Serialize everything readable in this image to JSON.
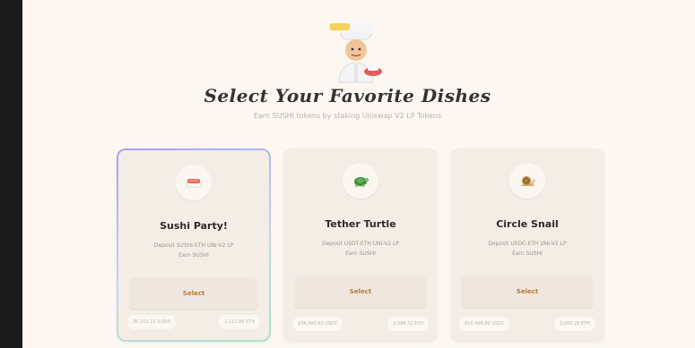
{
  "header": {
    "title": "Select Your Favorite Dishes",
    "subtitle": "Earn SUSHI tokens by staking Uniswap V2 LP Tokens",
    "mascot_icon": "chef-icon"
  },
  "cards": [
    {
      "name": "Sushi Party!",
      "icon": "sushi-icon",
      "desc_line1": "Deposit SUSHI-ETH UNI-V2 LP",
      "desc_line2": "Earn SUSHI",
      "button_label": "Select",
      "stat_left": "20,101.22 SUSHI",
      "stat_right": "1,111.86 ETH",
      "selected": true
    },
    {
      "name": "Tether Turtle",
      "icon": "turtle-icon",
      "desc_line1": "Deposit USDT-ETH UNI-V2 LP",
      "desc_line2": "Earn SUSHI",
      "button_label": "Select",
      "stat_left": "836,489.83 USDT",
      "stat_right": "3,098.52 ETH",
      "selected": false
    },
    {
      "name": "Circle Snail",
      "icon": "snail-icon",
      "desc_line1": "Deposit USDC-ETH UNI-V2 LP",
      "desc_line2": "Earn SUSHI",
      "button_label": "Select",
      "stat_left": "815,408.80 USDC",
      "stat_right": "3,000.28 ETH",
      "selected": false
    }
  ],
  "colors": {
    "background": "#fcf7f1",
    "card": "#f4ede6",
    "accent": "#b67a3c"
  }
}
